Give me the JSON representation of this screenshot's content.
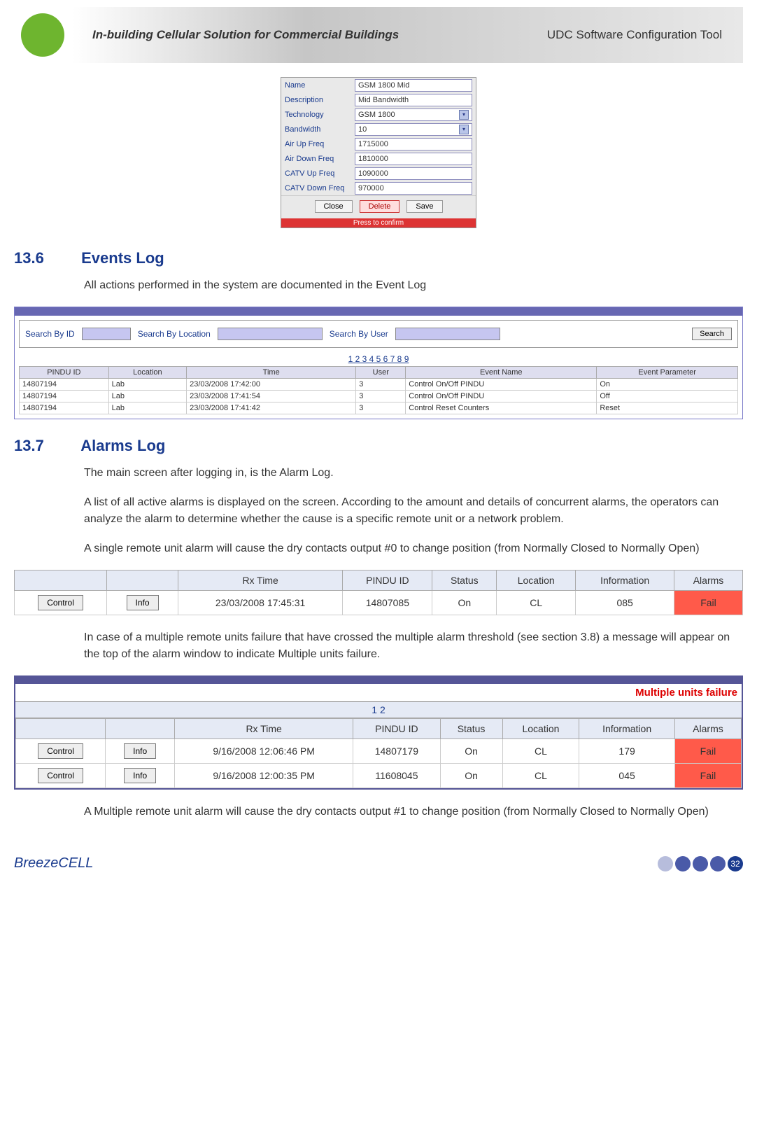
{
  "header": {
    "left_title": "In-building Cellular Solution for Commercial Buildings",
    "right_title": "UDC Software Configuration Tool"
  },
  "config_form": {
    "fields": [
      {
        "label": "Name",
        "value": "GSM 1800 Mid",
        "type": "text"
      },
      {
        "label": "Description",
        "value": "Mid Bandwidth",
        "type": "text"
      },
      {
        "label": "Technology",
        "value": "GSM 1800",
        "type": "select"
      },
      {
        "label": "Bandwidth",
        "value": "10",
        "type": "select"
      },
      {
        "label": "Air Up Freq",
        "value": "1715000",
        "type": "text"
      },
      {
        "label": "Air Down Freq",
        "value": "1810000",
        "type": "text"
      },
      {
        "label": "CATV Up Freq",
        "value": "1090000",
        "type": "text"
      },
      {
        "label": "CATV Down Freq",
        "value": "970000",
        "type": "text"
      }
    ],
    "buttons": {
      "close": "Close",
      "delete": "Delete",
      "save": "Save"
    },
    "confirm_hint": "Press to confirm"
  },
  "section_136": {
    "num": "13.6",
    "title": "Events Log",
    "para": "All actions performed in the system are documented in the Event Log"
  },
  "events_log": {
    "search": {
      "by_id": "Search By ID",
      "by_location": "Search By Location",
      "by_user": "Search By User",
      "button": "Search"
    },
    "pages": "1 2 3 4 5 6 7 8 9",
    "columns": [
      "PINDU ID",
      "Location",
      "Time",
      "User",
      "Event Name",
      "Event Parameter"
    ],
    "rows": [
      [
        "14807194",
        "Lab",
        "23/03/2008 17:42:00",
        "3",
        "Control On/Off PINDU",
        "On"
      ],
      [
        "14807194",
        "Lab",
        "23/03/2008 17:41:54",
        "3",
        "Control On/Off PINDU",
        "Off"
      ],
      [
        "14807194",
        "Lab",
        "23/03/2008 17:41:42",
        "3",
        "Control Reset Counters",
        "Reset"
      ]
    ]
  },
  "section_137": {
    "num": "13.7",
    "title": "Alarms Log",
    "p1": "The main screen after logging in, is the Alarm Log.",
    "p2": "A list of all active alarms is displayed on the screen. According to the amount and details of concurrent alarms, the operators can analyze the alarm to determine whether the cause is a specific remote unit or a network problem.",
    "p3": "A single remote unit alarm will cause the dry contacts output #0 to change position (from Normally Closed to Normally Open)",
    "p4": "In case of a multiple remote units failure that have crossed the multiple alarm threshold (see section 3.8) a message will appear on the top of the alarm window to indicate Multiple units failure.",
    "p5": "A Multiple remote unit alarm will cause the dry contacts output #1 to change position (from Normally Closed to Normally Open)"
  },
  "alarm_single": {
    "columns": [
      "",
      "",
      "Rx Time",
      "PINDU ID",
      "Status",
      "Location",
      "Information",
      "Alarms"
    ],
    "btn_control": "Control",
    "btn_info": "Info",
    "row": [
      "23/03/2008 17:45:31",
      "14807085",
      "On",
      "CL",
      "085",
      "Fail"
    ]
  },
  "alarm_multi": {
    "warning": "Multiple units failure",
    "pages": "1 2",
    "columns": [
      "",
      "",
      "Rx Time",
      "PINDU ID",
      "Status",
      "Location",
      "Information",
      "Alarms"
    ],
    "btn_control": "Control",
    "btn_info": "Info",
    "rows": [
      [
        "9/16/2008 12:06:46 PM",
        "14807179",
        "On",
        "CL",
        "179",
        "Fail"
      ],
      [
        "9/16/2008 12:00:35 PM",
        "11608045",
        "On",
        "CL",
        "045",
        "Fail"
      ]
    ]
  },
  "footer": {
    "brand": "BreezeCELL",
    "page": "32"
  }
}
